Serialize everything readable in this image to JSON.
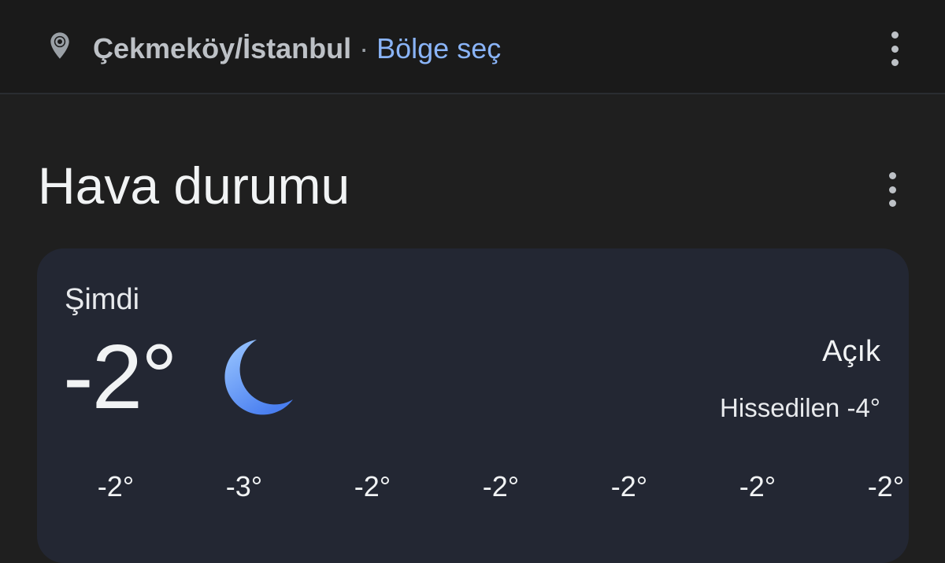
{
  "location_bar": {
    "city": "Çekmeköy/İstanbul",
    "separator": "·",
    "change_region_link": "Bölge seç",
    "icon": "location-pin-icon",
    "menu_icon": "more-vert-icon"
  },
  "weather": {
    "title": "Hava durumu",
    "menu_icon": "more-vert-icon",
    "now_label": "Şimdi",
    "temperature": "-2°",
    "condition_icon": "moon-icon",
    "condition": "Açık",
    "feels_like": "Hissedilen -4°",
    "hourly": [
      "-2°",
      "-3°",
      "-2°",
      "-2°",
      "-2°",
      "-2°",
      "-2°"
    ]
  },
  "colors": {
    "link": "#8ab4f8",
    "card_bg": "#232733",
    "page_bg": "#1f1f1f",
    "moon_top": "#8fc1ff",
    "moon_bottom": "#4a84f0"
  }
}
